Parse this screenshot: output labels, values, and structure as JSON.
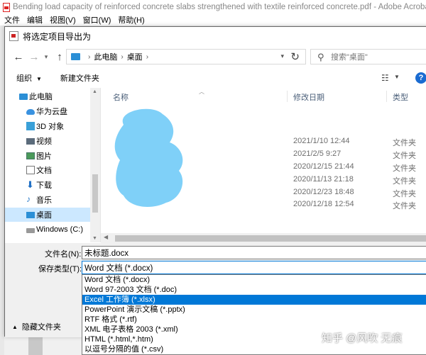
{
  "app": {
    "title": "Bending load capacity of reinforced concrete slabs strengthened with textile reinforced concrete.pdf - Adobe Acrobat",
    "menu": [
      "文件",
      "编辑",
      "视图(V)",
      "窗口(W)",
      "帮助(H)"
    ]
  },
  "dialog": {
    "title": "将选定项目导出为",
    "address": {
      "root": "此电脑",
      "leaf": "桌面"
    },
    "search_placeholder": "搜索\"桌面\"",
    "toolbar": {
      "organize": "组织",
      "new_folder": "新建文件夹"
    },
    "nav": [
      {
        "label": "此电脑",
        "icon": "computer-icon"
      },
      {
        "label": "华为云盘",
        "icon": "cloud-icon"
      },
      {
        "label": "3D 对象",
        "icon": "cube-icon"
      },
      {
        "label": "视频",
        "icon": "video-icon"
      },
      {
        "label": "图片",
        "icon": "picture-icon"
      },
      {
        "label": "文档",
        "icon": "document-icon"
      },
      {
        "label": "下载",
        "icon": "download-icon"
      },
      {
        "label": "音乐",
        "icon": "music-icon"
      },
      {
        "label": "桌面",
        "icon": "desktop-icon"
      },
      {
        "label": "Windows (C:)",
        "icon": "drive-icon"
      }
    ],
    "columns": {
      "name": "名称",
      "modified": "修改日期",
      "type": "类型"
    },
    "files": [
      {
        "modified": "2021/1/10 12:44",
        "type": "文件夹"
      },
      {
        "modified": "2021/2/5 9:27",
        "type": "文件夹"
      },
      {
        "modified": "2020/12/15 21:44",
        "type": "文件夹"
      },
      {
        "modified": "2020/11/13 21:18",
        "type": "文件夹"
      },
      {
        "modified": "2020/12/23 18:48",
        "type": "文件夹"
      },
      {
        "modified": "2020/12/18 12:54",
        "type": "文件夹"
      }
    ],
    "filename_label": "文件名(N):",
    "filename_value": "未标题.docx",
    "filetype_label": "保存类型(T):",
    "filetype_value": "Word 文档 (*.docx)",
    "filetype_options": [
      "Word 文档 (*.docx)",
      "Word 97-2003 文档 (*.doc)",
      "Excel 工作簿 (*.xlsx)",
      "PowerPoint 演示文稿 (*.pptx)",
      "RTF 格式 (*.rtf)",
      "XML 电子表格 2003 (*.xml)",
      "HTML (*.html,*.htm)",
      "以逗号分隔的值 (*.csv)"
    ],
    "highlighted_option": "Excel 工作簿 (*.xlsx)",
    "hide_folders": "隐藏文件夹"
  },
  "watermark": "知乎 @风吹 无痕",
  "colors": {
    "accent": "#0078d7",
    "selection": "#cce8ff",
    "redaction": "#7fd0f8"
  }
}
